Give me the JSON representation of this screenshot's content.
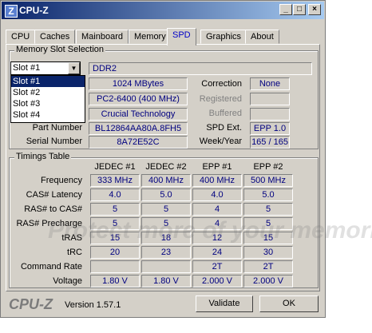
{
  "window": {
    "title": "CPU-Z"
  },
  "tabs": [
    "CPU",
    "Caches",
    "Mainboard",
    "Memory",
    "SPD",
    "Graphics",
    "About"
  ],
  "memory_slot": {
    "group_title": "Memory Slot Selection",
    "selected": "Slot #1",
    "options": [
      "Slot #1",
      "Slot #2",
      "Slot #3",
      "Slot #4"
    ],
    "type": "DDR2",
    "size": "1024 MBytes",
    "bandwidth": "PC2-6400 (400 MHz)",
    "manufacturer": "Crucial Technology",
    "part_number_label": "Part Number",
    "part_number": "BL12864AA80A.8FH5",
    "serial_number_label": "Serial Number",
    "serial_number": "8A72E52C",
    "correction_label": "Correction",
    "correction": "None",
    "registered_label": "Registered",
    "buffered_label": "Buffered",
    "spd_ext_label": "SPD Ext.",
    "spd_ext": "EPP 1.0",
    "week_year_label": "Week/Year",
    "week_year": "165 / 165"
  },
  "timings": {
    "group_title": "Timings Table",
    "columns": [
      "JEDEC #1",
      "JEDEC #2",
      "EPP #1",
      "EPP #2"
    ],
    "rows": [
      {
        "label": "Frequency",
        "values": [
          "333 MHz",
          "400 MHz",
          "400 MHz",
          "500 MHz"
        ]
      },
      {
        "label": "CAS# Latency",
        "values": [
          "4.0",
          "5.0",
          "4.0",
          "5.0"
        ]
      },
      {
        "label": "RAS# to CAS#",
        "values": [
          "5",
          "5",
          "4",
          "5"
        ]
      },
      {
        "label": "RAS# Precharge",
        "values": [
          "5",
          "5",
          "4",
          "5"
        ]
      },
      {
        "label": "tRAS",
        "values": [
          "15",
          "18",
          "12",
          "15"
        ]
      },
      {
        "label": "tRC",
        "values": [
          "20",
          "23",
          "24",
          "30"
        ]
      },
      {
        "label": "Command Rate",
        "values": [
          "",
          "",
          "2T",
          "2T"
        ]
      },
      {
        "label": "Voltage",
        "values": [
          "1.80 V",
          "1.80 V",
          "2.000 V",
          "2.000 V"
        ]
      }
    ]
  },
  "footer": {
    "logo": "CPU-Z",
    "version": "Version 1.57.1",
    "validate_label": "Validate",
    "ok_label": "OK"
  },
  "watermark": "Protect more of your memories for less!",
  "colors": {
    "accent_text": "#000080",
    "titlebar_start": "#0a246a",
    "titlebar_end": "#a6caf0"
  }
}
